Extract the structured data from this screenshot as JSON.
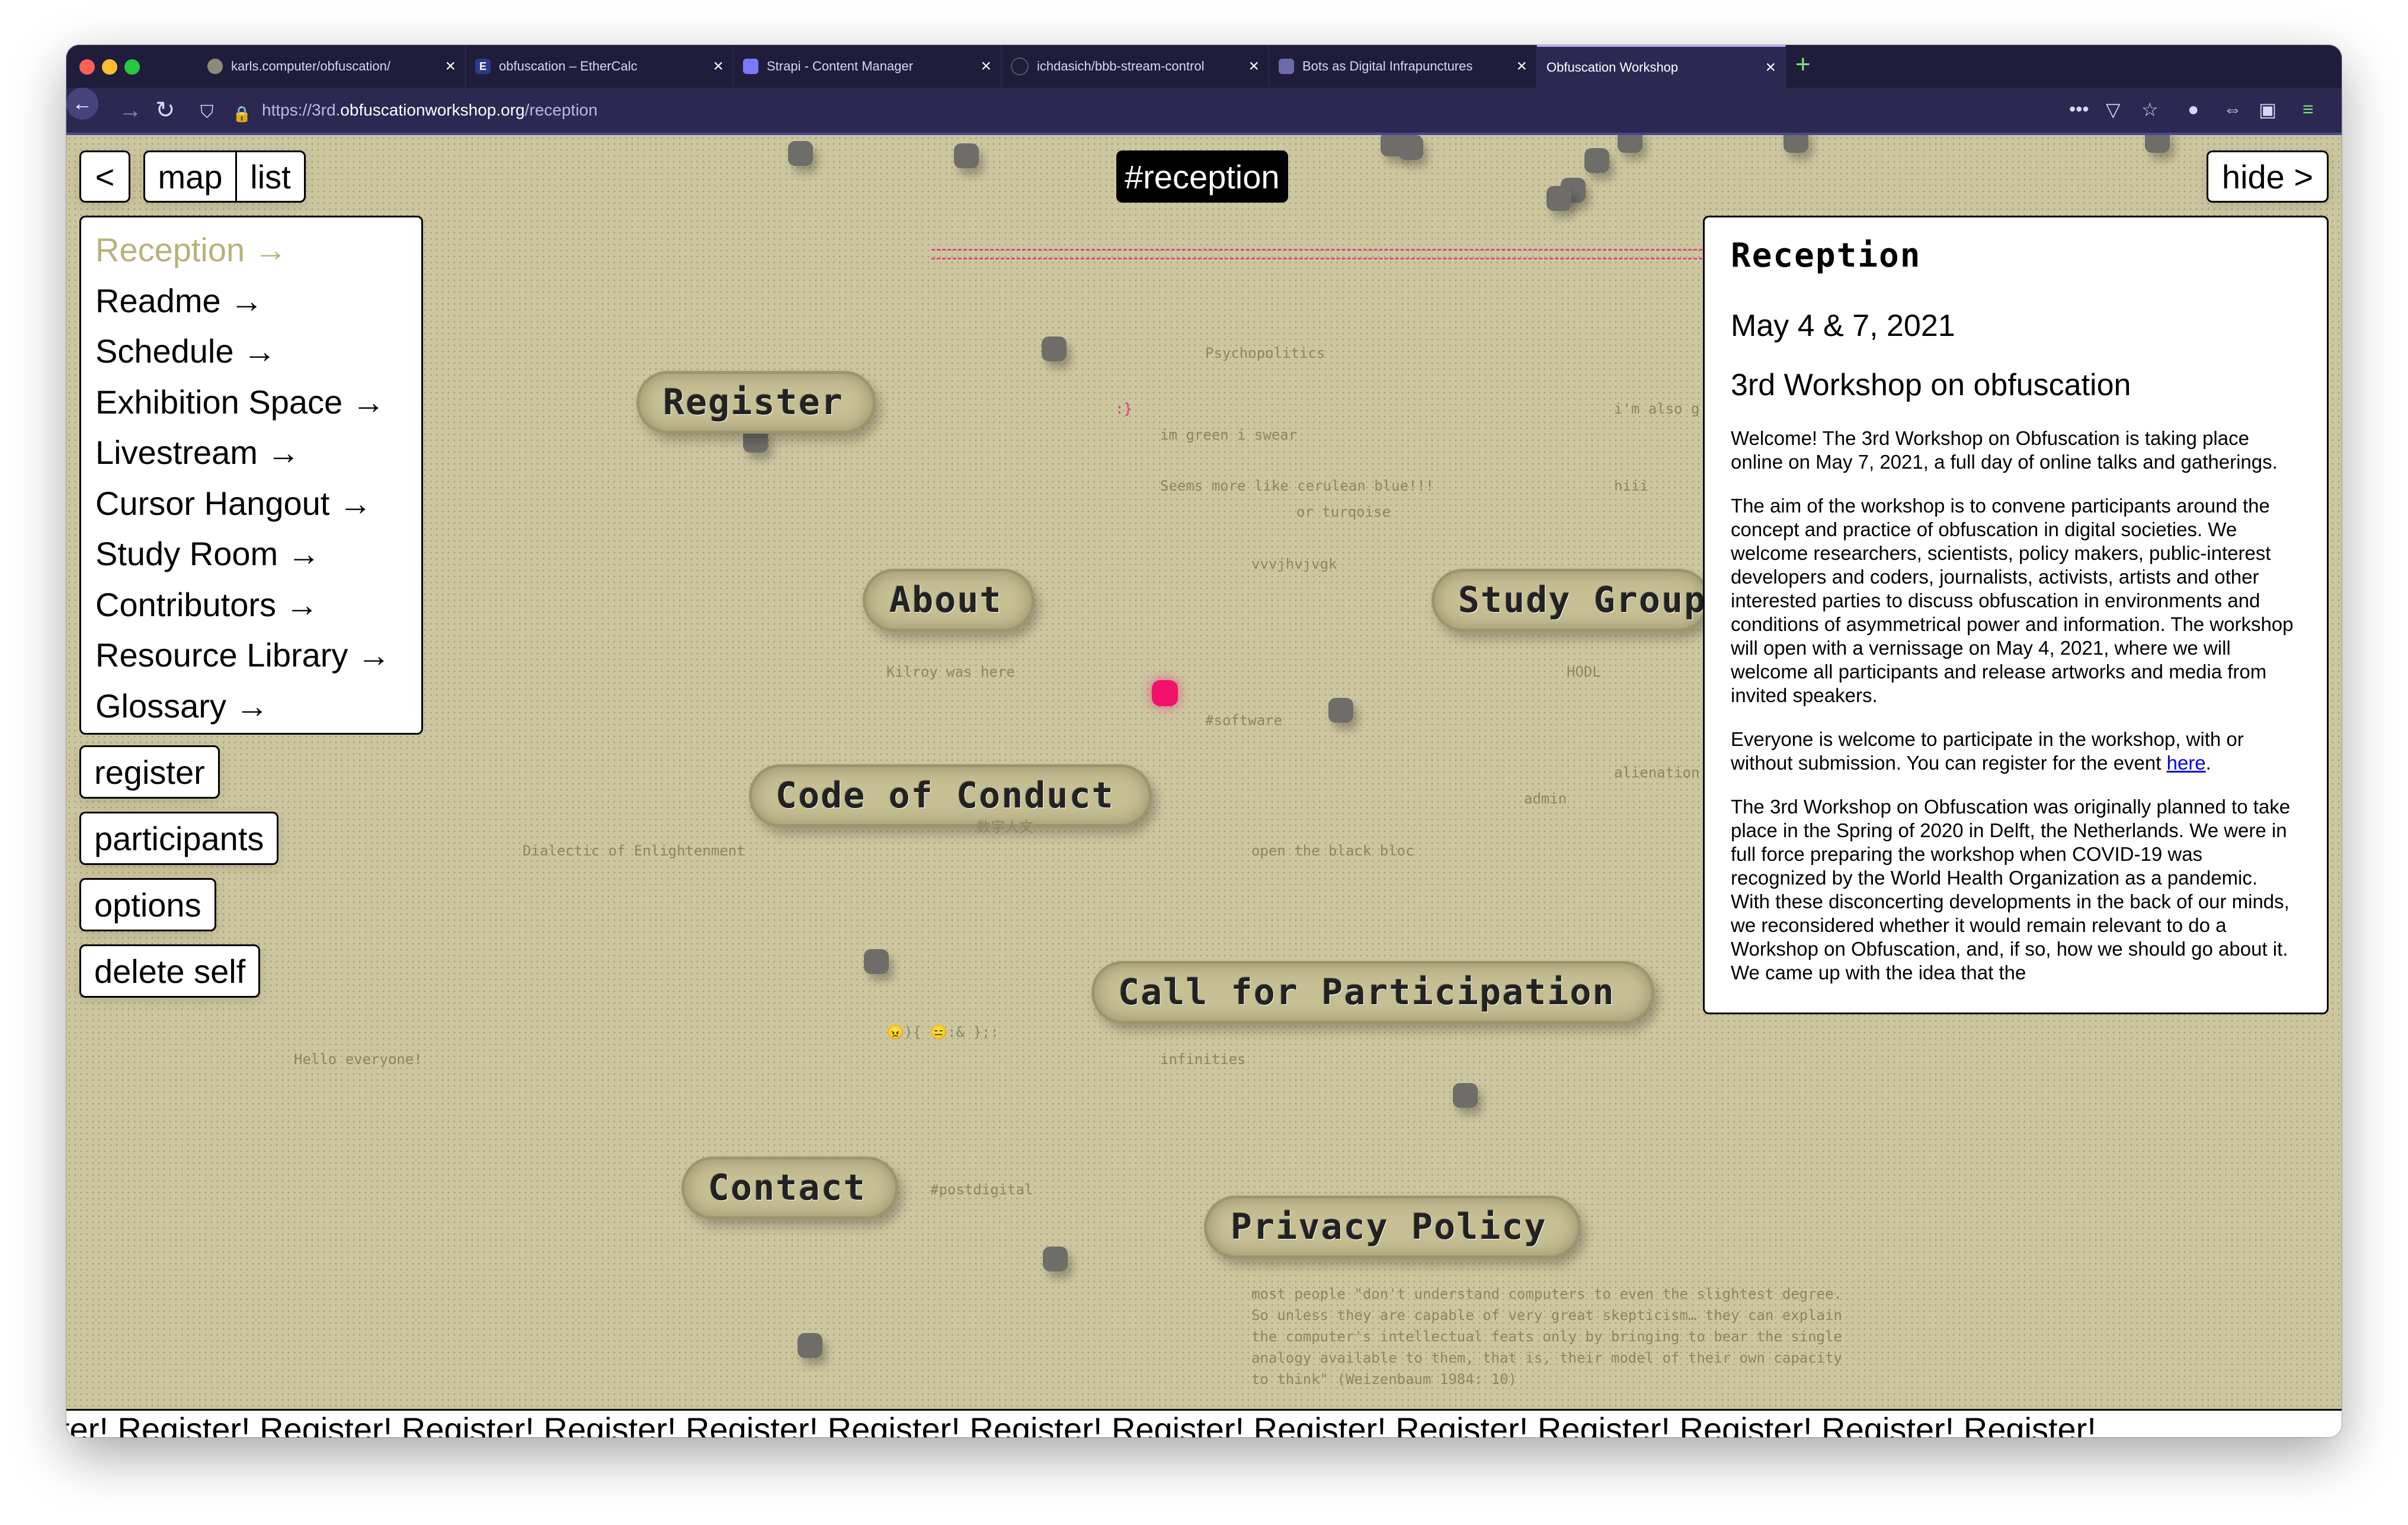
{
  "browser": {
    "tabs": [
      {
        "title": "karls.computer/obfuscation/",
        "active": false
      },
      {
        "title": "obfuscation – EtherCalc",
        "active": false
      },
      {
        "title": "Strapi - Content Manager",
        "active": false
      },
      {
        "title": "ichdasich/bbb-stream-control",
        "active": false
      },
      {
        "title": "Bots as Digital Infrapunctures",
        "active": false
      },
      {
        "title": "Obfuscation Workshop",
        "active": true
      }
    ],
    "new_tab": "+",
    "url_prefix": "https://3rd.",
    "url_host": "obfuscationworkshop.org",
    "url_path": "/reception",
    "colors": {
      "chrome": "#1f1d3b",
      "toolbar": "#2b2852",
      "accent": "#7ae37a"
    }
  },
  "nav": {
    "back": "<",
    "map": "map",
    "list": "list",
    "hide": "hide >",
    "room_title": "#reception"
  },
  "menu": {
    "items": [
      {
        "label": "Reception →"
      },
      {
        "label": "Readme →"
      },
      {
        "label": "Schedule →"
      },
      {
        "label": "Exhibition Space →"
      },
      {
        "label": "Livestream →"
      },
      {
        "label": "Cursor Hangout →"
      },
      {
        "label": "Study Room →"
      },
      {
        "label": "Contributors →"
      },
      {
        "label": "Resource Library →"
      },
      {
        "label": "Glossary →"
      }
    ]
  },
  "actions": {
    "register": "register",
    "participants": "participants",
    "options": "options",
    "delete_self": "delete self"
  },
  "portals": {
    "register": "Register",
    "about": "About",
    "study_group": "Study Group",
    "code_of_conduct": "Code of Conduct",
    "call_for_participation": "Call for Participation",
    "contact": "Contact",
    "privacy_policy": "Privacy Policy"
  },
  "graffiti": {
    "psychopolitics": "Psychopolitics",
    "smiley": ":}",
    "green": "im green i swear",
    "cerulean": "Seems more like cerulean blue!!!",
    "turquoise": "or turqoise",
    "also": "i'm also g",
    "hiii": "hiii",
    "vvvj": "vvvjhvjvgk",
    "kilroy": "Kilroy was here",
    "hodl": "HODL",
    "software": "#software",
    "alienation": "alienation",
    "admin": "admin",
    "chinese": "数字人文",
    "dialectic": "Dialectic of Enlightenment",
    "black_bloc": "open the black bloc",
    "emoji": "😠){ 😑:& };:",
    "hello": "Hello everyone!",
    "infinities": "infinities",
    "postdigital": "#postdigital",
    "quote_1": "most people \"don't understand computers to even the slightest degree.",
    "quote_2": "So unless they are capable of very great skepticism… they can explain",
    "quote_3": "the computer's intellectual feats only by bringing to bear the single",
    "quote_4": "analogy available to them, that is, their model of their own capacity",
    "quote_5": "to think\" (Weizenbaum 1984: 10)"
  },
  "info": {
    "title": "Reception",
    "date": "May 4 & 7, 2021",
    "subtitle": "3rd Workshop on obfuscation",
    "p1": "Welcome! The 3rd Workshop on Obfuscation is taking place online on May 7, 2021, a full day of online talks and gatherings.",
    "p2": "The aim of the workshop is to convene participants around the concept and practice of obfuscation in digital societies. We welcome researchers, scientists, policy makers, public-interest developers and coders, journalists, activists, artists and other interested parties to discuss obfuscation in environments and conditions of asymmetrical power and information. The workshop will open with a vernissage on May 4, 2021, where we will welcome all participants and release artworks and media from invited speakers.",
    "p3_before": "Everyone is welcome to participate in the workshop, with or without submission. You can register for the event ",
    "p3_link": "here",
    "p3_after": ".",
    "p4": "The 3rd Workshop on Obfuscation was originally planned to take place in the Spring of 2020 in Delft, the Netherlands. We were in full force preparing the workshop when COVID-19 was recognized by the World Health Organization as a pandemic. With these disconcerting developments in the back of our minds, we reconsidered whether it would remain relevant to do a Workshop on Obfuscation, and, if so, how we should go about it. We came up with the idea that the"
  },
  "ticker": {
    "text": "ster! Register! Register! Register! Register! Register! Register! Register! Register! Register! Register! Register! Register! Register! Register!"
  },
  "page_colors": {
    "background": "#cdc7a0",
    "self_cursor": "#f0116a",
    "avatar": "#6f6d6a"
  }
}
